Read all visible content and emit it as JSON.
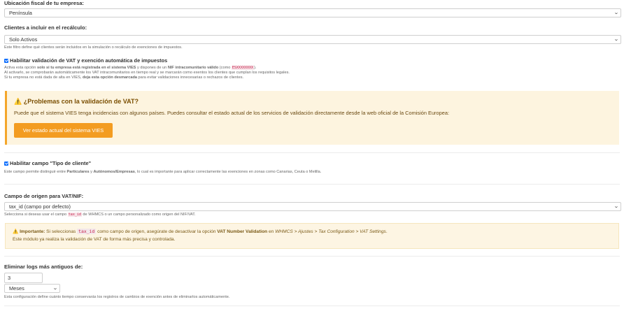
{
  "fiscal": {
    "label": "Ubicación fiscal de tu empresa:",
    "value": "Península"
  },
  "clients": {
    "label": "Clientes a incluir en el recálculo:",
    "value": "Solo Activos",
    "help": "Este filtro define qué clientes serán incluidos en la simulación o recálculo de exenciones de impuestos."
  },
  "vat": {
    "checkbox_label": "Habilitar validación de VAT y exención automática de impuestos",
    "line1_a": "Activa esta opción ",
    "line1_b": "solo si tu empresa está registrada en el sistema VIES",
    "line1_c": " y dispones de un ",
    "line1_d": "NIF intracomunitario válido",
    "line1_e": " (como ",
    "line1_code": "ESXXXXXXXX",
    "line1_f": ").",
    "line2": "Al activarlo, se comprobarán automáticamente los VAT intracomunitarios en tiempo real y se marcarán como exentos los clientes que cumplan los requisitos legales.",
    "line3_a": "Si tu empresa no está dada de alta en VIES, ",
    "line3_b": "deja esta opción desmarcada",
    "line3_c": " para evitar validaciones innecesarias o rechazos de clientes."
  },
  "vies_warning": {
    "icon": "⚠️",
    "title": "¿Problemas con la validación de VAT?",
    "text": "Puede que el sistema VIES tenga incidencias con algunos países. Puedes consultar el estado actual de los servicios de validación directamente desde la web oficial de la Comisión Europea:",
    "button": "Ver estado actual del sistema VIES",
    "accent": "#f39c21"
  },
  "client_type": {
    "checkbox_label": "Habilitar campo \"Tipo de cliente\"",
    "help_a": "Este campo permite distinguir entre ",
    "help_b": "Particulares",
    "help_c": " y ",
    "help_d": "Autónomos/Empresas",
    "help_e": ", lo cual es importante para aplicar correctamente las exenciones en zonas como Canarias, Ceuta o Melilla."
  },
  "origin": {
    "label": "Campo de origen para VAT/NIF:",
    "value": "tax_id (campo por defecto)",
    "help_a": "Selecciona si deseas usar el campo ",
    "help_code": "tax_id",
    "help_b": " de WHMCS o un campo personalizado como origen del NIF/VAT."
  },
  "important": {
    "icon": "⚠️",
    "strong": "Importante:",
    "a": " Si seleccionas ",
    "code": "tax_id",
    "b": " como campo de origen, asegúrate de desactivar la opción ",
    "c": "VAT Number Validation",
    "d": " en ",
    "e": "WHMCS > Ajustes > Tax Configuration > VAT Settings",
    "f": ".",
    "line2": "Este módulo ya realiza la validación de VAT de forma más precisa y controlada."
  },
  "logs": {
    "label": "Eliminar logs más antiguos de:",
    "number": "3",
    "unit": "Meses",
    "help": "Esta configuración define cuánto tiempo conservarás los registros de cambios de exención antes de eliminarlos automáticamente."
  },
  "colors": {
    "checkbox": "#0d6efd",
    "warning_bg": "#fdf4df",
    "warning_border": "#f4a62a"
  }
}
